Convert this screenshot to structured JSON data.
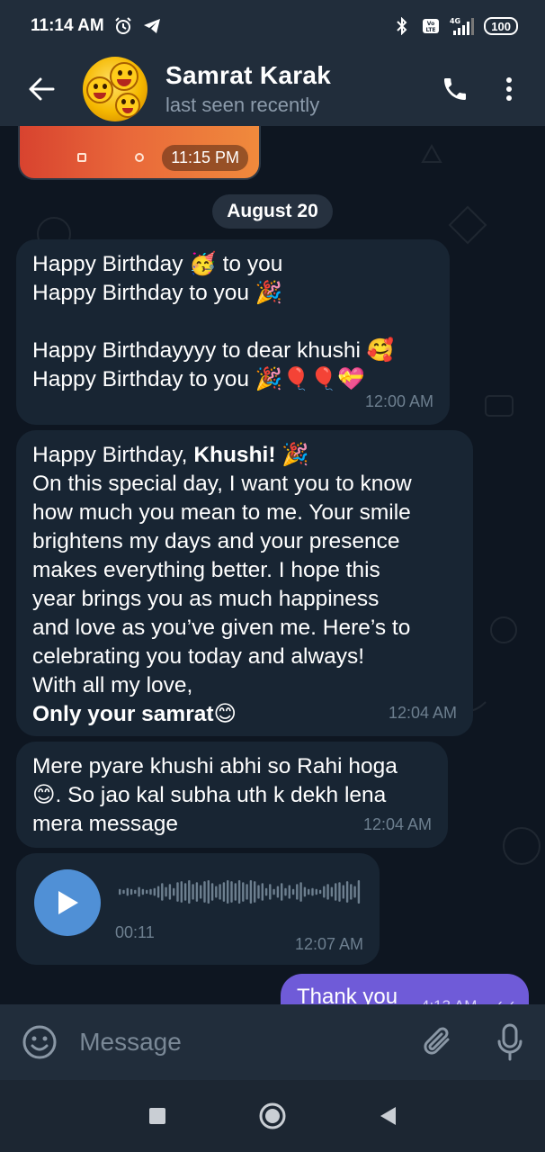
{
  "status_bar": {
    "time": "11:14 AM",
    "network": "4G",
    "volte": "Vo LTE",
    "battery": "100"
  },
  "header": {
    "contact_name": "Samrat Karak",
    "contact_status": "last seen recently"
  },
  "chat": {
    "media_time": "11:15 PM",
    "date_separator": "August 20",
    "messages": [
      {
        "lines": [
          "Happy Birthday 🥳 to you",
          "Happy Birthday to you 🎉",
          "",
          "Happy Birthdayyyy to dear khushi 🥰",
          "Happy Birthday to you 🎉🎈🎈💝"
        ],
        "time": "12:00 AM"
      },
      {
        "greeting": "Happy Birthday, ",
        "greeting_name": "Khushi!",
        "greeting_emoji": " 🎉",
        "lines": [
          "On this special day, I want you to know",
          "how much you mean to me. Your smile",
          "brightens my days and your presence",
          "makes everything better. I hope this",
          "year brings you as much happiness",
          "and love as you’ve given me. Here’s to",
          "celebrating you today and always!",
          "With all my love,"
        ],
        "signoff": "Only your samrat",
        "signoff_emoji": "😊",
        "time": "12:04 AM"
      },
      {
        "lines": [
          "Mere pyare khushi abhi so Rahi hoga",
          "😊.  So jao kal subha uth k dekh lena",
          "mera message"
        ],
        "time": "12:04 AM"
      }
    ],
    "voice": {
      "duration": "00:11",
      "time": "12:07 AM",
      "waveform": [
        3,
        2,
        4,
        3,
        2,
        5,
        3,
        2,
        3,
        4,
        6,
        9,
        5,
        8,
        4,
        10,
        11,
        9,
        12,
        8,
        10,
        7,
        11,
        12,
        9,
        6,
        8,
        10,
        12,
        11,
        9,
        12,
        10,
        8,
        12,
        11,
        7,
        9,
        4,
        8,
        3,
        6,
        9,
        4,
        7,
        3,
        8,
        10,
        5,
        3,
        4,
        3,
        2,
        6,
        8,
        5,
        9,
        10,
        7,
        11,
        8,
        6,
        12
      ]
    },
    "outgoing": {
      "text": "Thank you",
      "time": "4:13 AM",
      "status": "✓✓"
    }
  },
  "input": {
    "placeholder": "Message"
  },
  "colors": {
    "background": "#0e1621",
    "bar": "#212d3b",
    "incoming_bubble": "#182533",
    "outgoing_bubble": "#6f5bd8",
    "accent": "#5090d6"
  }
}
